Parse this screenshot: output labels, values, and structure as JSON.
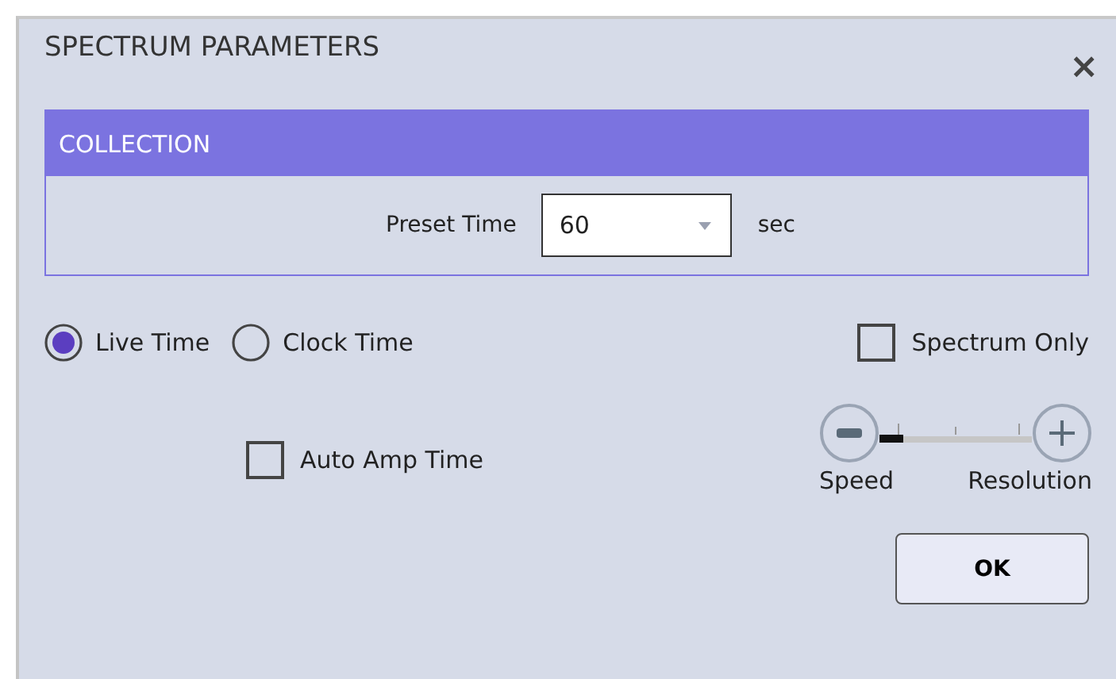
{
  "window": {
    "title": "SPECTRUM PARAMETERS",
    "close": "×"
  },
  "collection": {
    "title": "COLLECTION",
    "label": "Preset Time",
    "value": "60",
    "unit": "sec"
  },
  "time_modes": [
    {
      "label": "Live Time",
      "selected": true
    },
    {
      "label": "Clock Time",
      "selected": false
    }
  ],
  "spectrum_only": {
    "label": "Spectrum Only",
    "checked": false
  },
  "auto_amp_time": {
    "label": "Auto Amp Time",
    "checked": false
  },
  "slider": {
    "left_label": "Speed",
    "right_label": "Resolution",
    "level": 0
  },
  "buttons": [
    "OK"
  ]
}
